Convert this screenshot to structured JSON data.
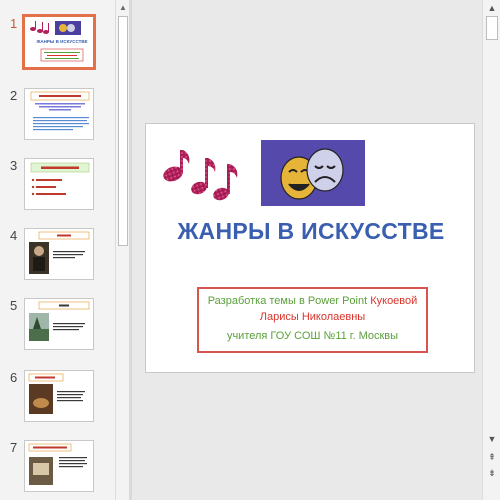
{
  "thumbnails": [
    {
      "number": "1",
      "title": "ЖАНРЫ В ИСКУССТВЕ",
      "active": true
    },
    {
      "number": "2",
      "title": "Жанр (франц. genre — род, вид)",
      "active": false
    },
    {
      "number": "3",
      "title": "Жанры живописи",
      "active": false
    },
    {
      "number": "4",
      "title": "Портрет",
      "active": false
    },
    {
      "number": "5",
      "title": "Пейзаж",
      "active": false
    },
    {
      "number": "6",
      "title": "Натюрморт",
      "active": false
    },
    {
      "number": "7",
      "title": "Жанры в литературе",
      "active": false
    }
  ],
  "slide": {
    "title": "ЖАНРЫ В ИСКУССТВЕ",
    "info_line1": "Разработка темы в Power Point",
    "info_surname": "Кукоевой",
    "info_line2": "Ларисы Николаевны",
    "info_line3": "учителя ГОУ СОШ №11 г. Москвы"
  },
  "icons": {
    "scroll_up": "▲",
    "scroll_down": "▼",
    "prev_slide": "⇞",
    "next_slide": "⇟"
  },
  "colors": {
    "active_border": "#e4704a",
    "title_blue": "#3a5fb0",
    "info_green": "#5aa03a",
    "info_red": "#d9342b"
  }
}
